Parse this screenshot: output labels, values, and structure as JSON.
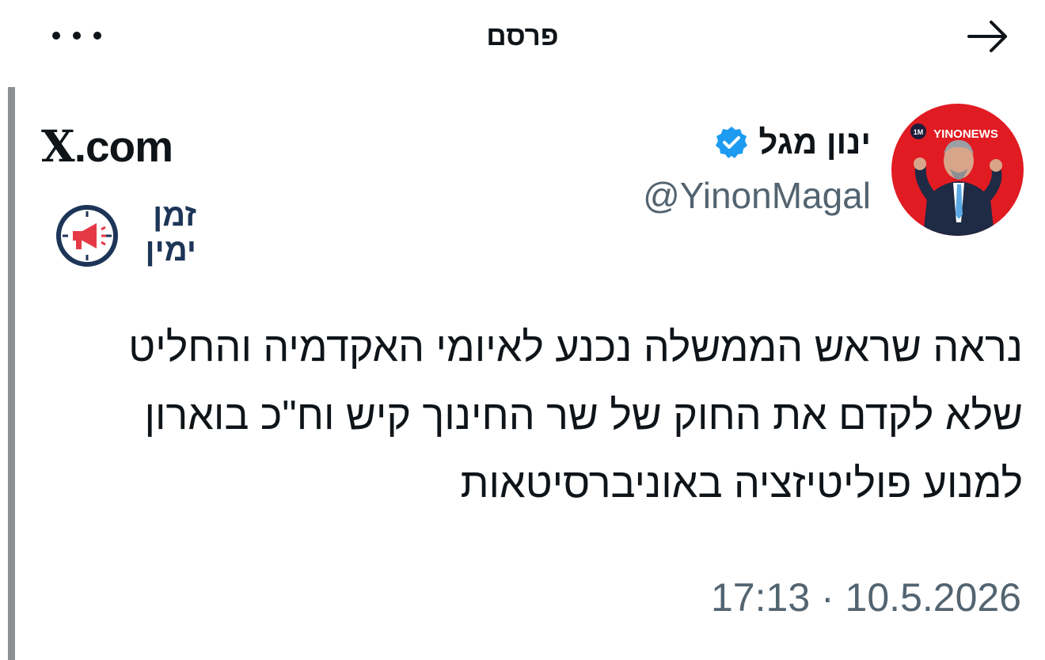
{
  "header": {
    "title": "פרסם",
    "more_icon": "more-horizontal-icon",
    "back_icon": "arrow-right-icon"
  },
  "author": {
    "name": "ינון מגל",
    "handle": "@YinonMagal",
    "verified_icon": "verified-badge-icon",
    "verified_color": "#1d9bf0",
    "avatar": {
      "badge_text": "1M",
      "brand_text": "YINONEWS",
      "background_color": "#e11b22"
    }
  },
  "source": {
    "x_letter": "X",
    "domain_suffix": ".com"
  },
  "channel_logo": {
    "line1": "זמן",
    "line2": "ימין",
    "color": "#1d3557",
    "accent": "#e63946"
  },
  "tweet": {
    "lines": [
      "נראה שראש הממשלה נכנע לאיומי האקדמיה והחליט",
      "שלא לקדם את החוק של שר החינוך קיש וח\"כ בוארון",
      "למנוע פוליטיזציה באוניברסיטאות"
    ],
    "timestamp": "17:13 · 10.5.2026"
  }
}
